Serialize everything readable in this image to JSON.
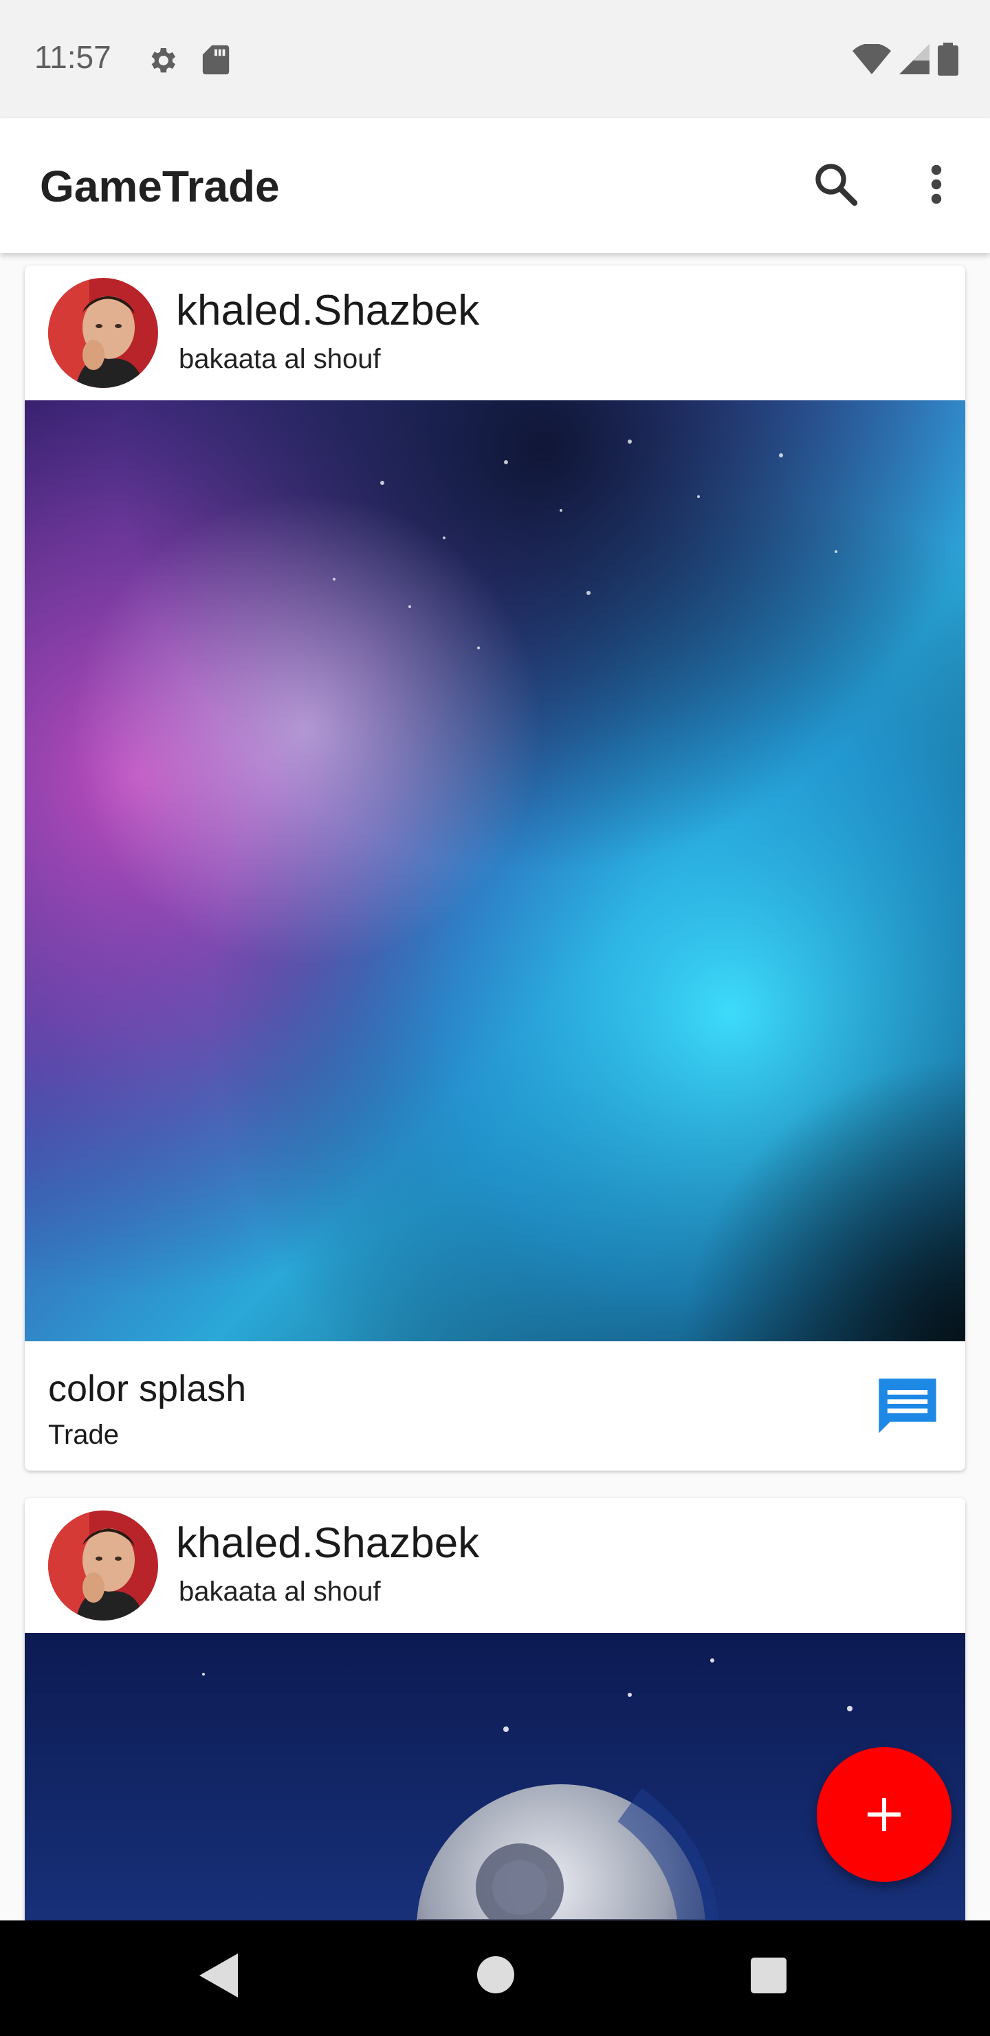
{
  "status_bar": {
    "time": "11:57",
    "icons": [
      "gear-icon",
      "sd-card-icon",
      "wifi-icon",
      "signal-icon",
      "battery-icon"
    ]
  },
  "app_bar": {
    "title": "GameTrade",
    "actions": [
      "search-icon",
      "more-vert-icon"
    ]
  },
  "feed": {
    "posts": [
      {
        "user_name": "khaled.Shazbek",
        "location": "bakaata al shouf",
        "image": "nebula-color-splash",
        "title": "color splash",
        "type": "Trade",
        "action_icon": "chat-icon"
      },
      {
        "user_name": "khaled.Shazbek",
        "location": "bakaata al shouf",
        "image": "death-star-space"
      }
    ]
  },
  "fab": {
    "icon": "plus-icon"
  },
  "colors": {
    "accent_fab": "#ff0000",
    "chat_blue": "#1e88e5",
    "status_bar_bg": "#f2f2f2",
    "nav_bar_bg": "#000000"
  }
}
